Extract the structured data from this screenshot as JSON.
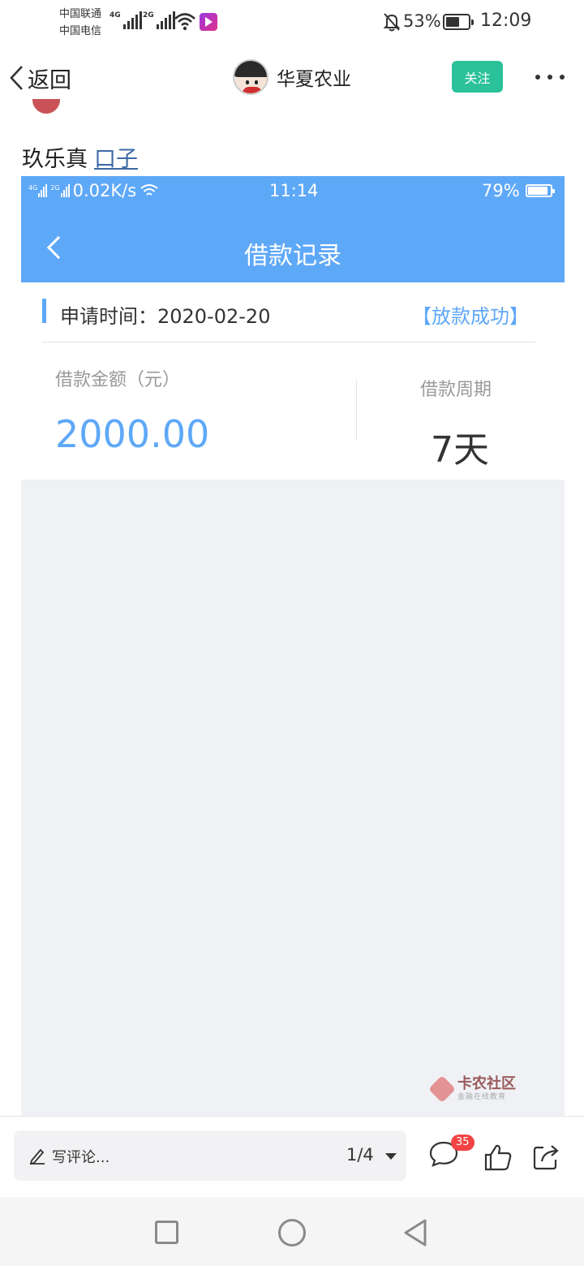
{
  "status_bar": {
    "carrier_1": "中国联通",
    "carrier_2": "中国电信",
    "network_1": "4G",
    "network_2": "2G",
    "battery": "53%",
    "time": "12:09"
  },
  "app_bar": {
    "back_label": "返回",
    "author_name": "华夏农业",
    "follow_label": "关注"
  },
  "post": {
    "text": "玖乐真",
    "link_text": "口子"
  },
  "screenshot": {
    "status": {
      "network_1": "4G",
      "network_2": "2G",
      "speed": "0.02K/s",
      "time": "11:14",
      "battery": "79%"
    },
    "title": "借款记录",
    "apply_label": "申请时间：2020-02-20",
    "apply_status": "【放款成功】",
    "amount_label": "借款金额（元）",
    "amount_value": "2000.00",
    "period_label": "借款周期",
    "period_value": "7天",
    "watermark_main": "卡农社区",
    "watermark_sub": "金融在线教育"
  },
  "comment_bar": {
    "placeholder": "写评论...",
    "page_indicator": "1/4",
    "comment_count": "35"
  },
  "colors": {
    "accent_blue": "#5ea8f8",
    "follow_green": "#2bc19a",
    "badge_red": "#f24444"
  },
  "icons": [
    "signal-icon",
    "wifi-icon",
    "app-badge-icon",
    "bell-off-icon",
    "battery-icon",
    "back-chevron-icon",
    "more-icon",
    "pencil-icon",
    "dropdown-caret-icon",
    "comment-icon",
    "thumbs-up-icon",
    "share-icon",
    "nav-recent-icon",
    "nav-home-icon",
    "nav-back-icon"
  ]
}
